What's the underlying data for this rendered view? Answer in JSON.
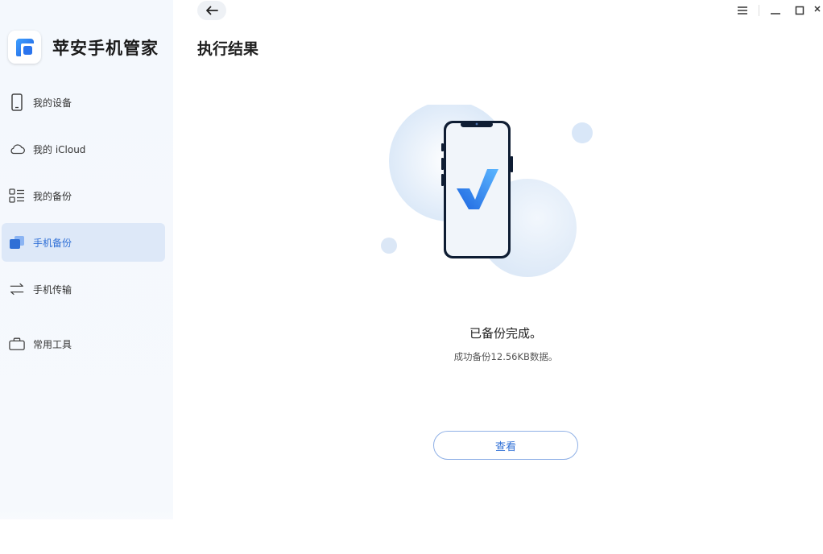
{
  "app": {
    "name": "苹安手机管家",
    "brand_color": "#2f7bea"
  },
  "sidebar": {
    "items": [
      {
        "label": "我的设备",
        "icon": "phone-outline-icon",
        "active": false
      },
      {
        "label": "我的 iCloud",
        "icon": "cloud-icon",
        "active": false
      },
      {
        "label": "我的备份",
        "icon": "list-grid-icon",
        "active": false
      },
      {
        "label": "手机备份",
        "icon": "phone-backup-icon",
        "active": true
      },
      {
        "label": "手机传输",
        "icon": "transfer-arrows-icon",
        "active": false
      },
      {
        "label": "常用工具",
        "icon": "toolbox-icon",
        "active": false
      }
    ]
  },
  "main": {
    "title": "执行结果",
    "result_title": "已备份完成。",
    "result_detail": "成功备份12.56KB数据。",
    "view_button": "查看",
    "accent_color": "#2f6fd6"
  },
  "window_controls": [
    "menu-icon",
    "minimize-icon",
    "maximize-icon",
    "close-icon"
  ]
}
